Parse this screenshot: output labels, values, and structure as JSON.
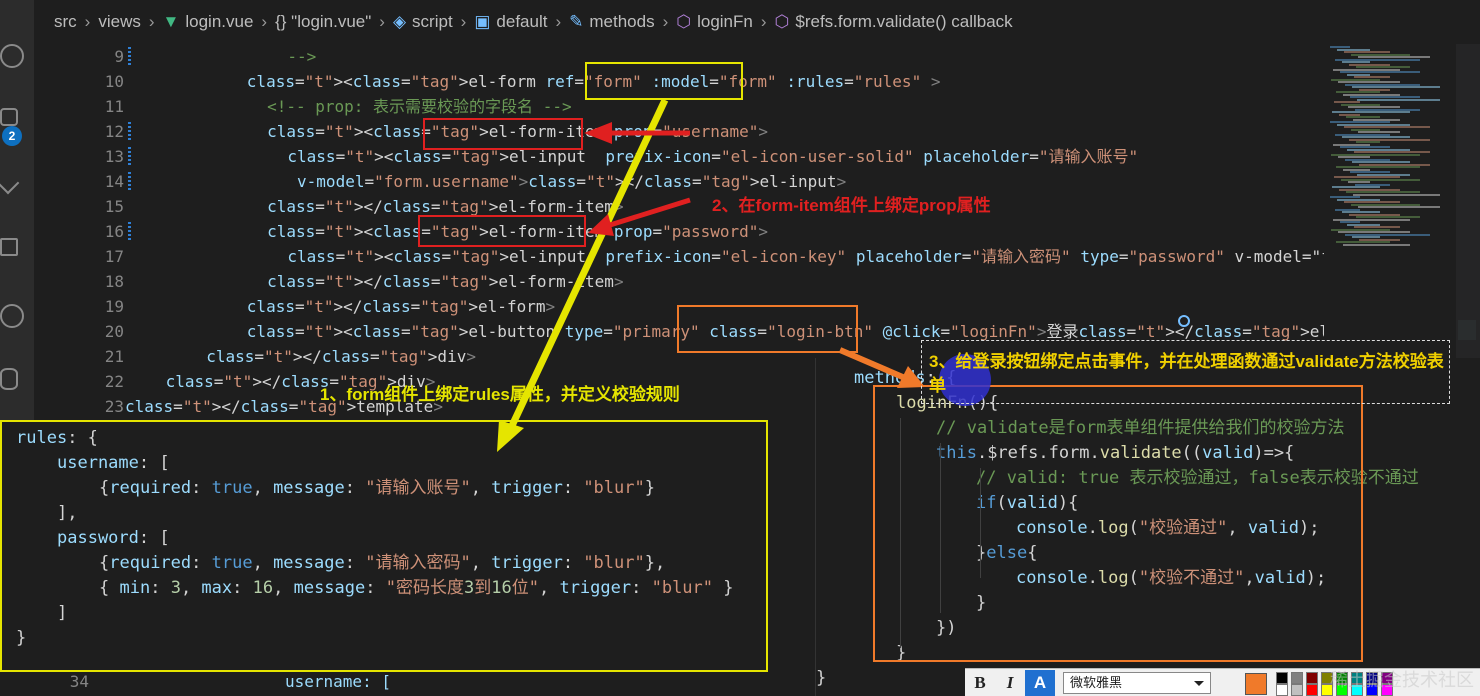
{
  "breadcrumb": {
    "items": [
      "src",
      "views",
      "login.vue",
      "{} \"login.vue\"",
      "script",
      "default",
      "methods",
      "loginFn",
      "$refs.form.validate() callback"
    ]
  },
  "activity": {
    "badge_count": "2"
  },
  "editor": {
    "lines": [
      {
        "n": "9",
        "text": "-->"
      },
      {
        "n": "10",
        "text": "<el-form ref=\"form\" :model=\"form\" :rules=\"rules\" >"
      },
      {
        "n": "11",
        "text": "<!-- prop: 表示需要校验的字段名 -->"
      },
      {
        "n": "12",
        "text": "<el-form-item prop=\"username\">"
      },
      {
        "n": "13",
        "text": "<el-input  prefix-icon=\"el-icon-user-solid\" placeholder=\"请输入账号\""
      },
      {
        "n": "14",
        "text": " v-model=\"form.username\"></el-input>"
      },
      {
        "n": "15",
        "text": "</el-form-item>"
      },
      {
        "n": "16",
        "text": "<el-form-item prop=\"password\">"
      },
      {
        "n": "17",
        "text": "<el-input  prefix-icon=\"el-icon-key\" placeholder=\"请输入密码\" type=\"password\" v-model=\"form.passwor"
      },
      {
        "n": "18",
        "text": "</el-form-item>"
      },
      {
        "n": "19",
        "text": "</el-form>"
      },
      {
        "n": "20",
        "text": "<el-button type=\"primary\" class=\"login-btn\" @click=\"loginFn\">登录</el-button>"
      },
      {
        "n": "21",
        "text": "</div>"
      },
      {
        "n": "22",
        "text": "</div>"
      },
      {
        "n": "23",
        "text": "</template>"
      }
    ],
    "bottom_line": {
      "n": "34",
      "text": "username: ["
    }
  },
  "rules_panel": {
    "lines": [
      "rules: {",
      "username: [",
      "{required: true, message: \"请输入账号\", trigger: \"blur\"}",
      "],",
      "password: [",
      "{required: true, message: \"请输入密码\", trigger: \"blur\"},",
      "{ min: 3, max: 16, message: \"密码长度3到16位\", trigger: \"blur\" }",
      "]",
      "}"
    ]
  },
  "methods_panel": {
    "lines": [
      "methods: {",
      "loginFn(){",
      "// validate是form表单组件提供给我们的校验方法",
      "this.$refs.form.validate((valid)=>{",
      "// valid: true 表示校验通过，false表示校验不通过",
      "if(valid){",
      "console.log(\"校验通过\", valid);",
      "}else{",
      "console.log(\"校验不通过\",valid);",
      "}",
      "})",
      "}",
      "}"
    ]
  },
  "annotations": {
    "note1": "1、form组件上绑定rules属性，并定义校验规则",
    "note2": "2、在form-item组件上绑定prop属性",
    "note3": "3、给登录按钮绑定点击事件，并在处理函数通过validate方法校验表单"
  },
  "toolbar": {
    "bold": "B",
    "italic": "I",
    "font_color": "A",
    "font_name": "微软雅黑"
  },
  "watermark": "稀土掘金技术社区",
  "colors": {
    "yellow_box": "#e5e500",
    "red_box": "#e02020",
    "orange_box": "#f07a2a"
  }
}
